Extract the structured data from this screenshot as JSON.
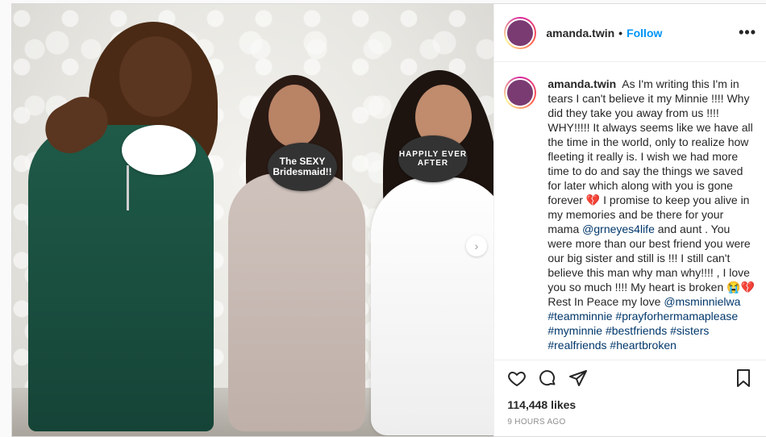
{
  "post": {
    "username": "amanda.twin",
    "dot": "•",
    "follow_label": "Follow",
    "more_label": "•••",
    "photo": {
      "sign1": "The SEXY Bridesmaid!!",
      "sign2": "HAPPILY EVER AFTER",
      "next_arrow": "›"
    },
    "caption": {
      "username": "amanda.twin",
      "part1": "As I'm writing this I'm in tears I can't believe it my Minnie !!!! Why did they take you away from us !!!! WHY!!!!! It always seems like we have all the time in the world, only to realize how fleeting it really is. I wish we had more time to do and say the things we saved for later which along with you is gone forever 💔 I promise to keep you alive in my memories and be there for your mama ",
      "mention1": "@grneyes4life",
      "part2": " and aunt . You were more than our best friend you were our big sister and still is !!! I still can't believe this man why man why!!!! , I love you so much !!!! My heart is broken 😭💔 Rest In Peace my love ",
      "mention2": "@msminnielwa",
      "space": " ",
      "tag1": "#teamminnie",
      "tag2": "#prayforhermamaplease",
      "tag3": "#myminnie",
      "tag4": "#bestfriends",
      "tag5": "#sisters",
      "tag6": "#realfriends",
      "tag7": "#heartbroken"
    },
    "likes": "114,448 likes",
    "time": "9 HOURS AGO"
  },
  "icons": {
    "like": "heart-icon",
    "comment": "comment-icon",
    "share": "paper-plane-icon",
    "save": "bookmark-icon"
  }
}
